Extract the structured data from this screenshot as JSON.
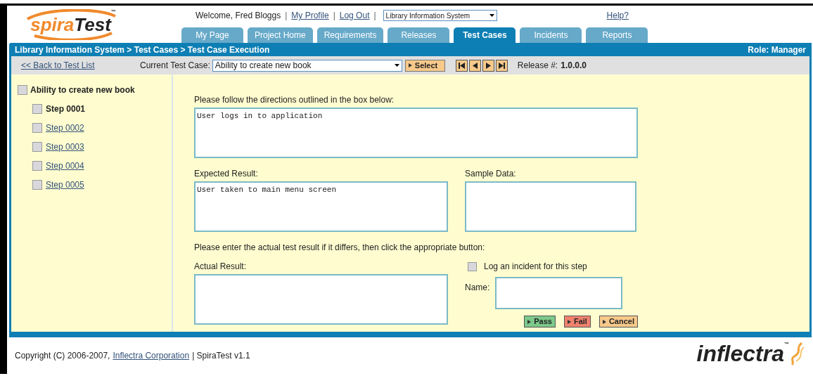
{
  "logo": {
    "part_1": "spira",
    "part_2": "Test",
    "mark": "™"
  },
  "user_bar": {
    "welcome": "Welcome, Fred Bloggs",
    "links": [
      "My Profile",
      "Log Out"
    ],
    "separators": [
      "|",
      "|",
      "|"
    ],
    "project_select": "Library Information System",
    "help": "Help?"
  },
  "tabs": [
    {
      "label": "My Page",
      "selected": false
    },
    {
      "label": "Project Home",
      "selected": false
    },
    {
      "label": "Requirements",
      "selected": false
    },
    {
      "label": "Releases",
      "selected": false
    },
    {
      "label": "Test Cases",
      "selected": true
    },
    {
      "label": "Incidents",
      "selected": false
    },
    {
      "label": "Reports",
      "selected": false
    }
  ],
  "breadcrumb": "Library Information System > Test Cases > Test Case Execution",
  "role": "Role: Manager",
  "toolbar": {
    "back_link": "<< Back to Test List",
    "test_case_label": "Current Test Case:",
    "test_case_value": "Ability to create new book",
    "select_button": "Select",
    "release_label": "Release #:",
    "release_value": "1.0.0.0"
  },
  "tree": {
    "label": "Ability to create new book",
    "checked": false,
    "children": [
      {
        "label": "Step 0001",
        "selected": true,
        "checked": false
      },
      {
        "label": "Step 0002",
        "selected": false,
        "checked": false
      },
      {
        "label": "Step 0003",
        "selected": false,
        "checked": false
      },
      {
        "label": "Step 0004",
        "selected": false,
        "checked": false
      },
      {
        "label": "Step 0005",
        "selected": false,
        "checked": false
      }
    ]
  },
  "directions": {
    "label": "Please follow the directions outlined in the box below:",
    "value": "User logs in to application"
  },
  "expected": {
    "label": "Expected Result:",
    "value": "User taken to main menu screen"
  },
  "sample": {
    "label": "Sample Data:"
  },
  "instruction": "Please enter the actual test result if it differs, then click the appropriate button:",
  "actual": {
    "label": "Actual Result:"
  },
  "incident": {
    "label": "Log an incident for this step",
    "checked": false,
    "name_label": "Name:"
  },
  "buttons": [
    {
      "label": "Pass",
      "kind": "pass"
    },
    {
      "label": "Fail",
      "kind": "fail"
    },
    {
      "label": "Cancel",
      "kind": "cancel"
    }
  ],
  "footer": {
    "copyright": "Copyright (C) 2006-2007,",
    "company": "Inflectra Corporation",
    "product": "| SpiraTest v1.1",
    "brand": "inflectra",
    "brand_mark": "™"
  }
}
